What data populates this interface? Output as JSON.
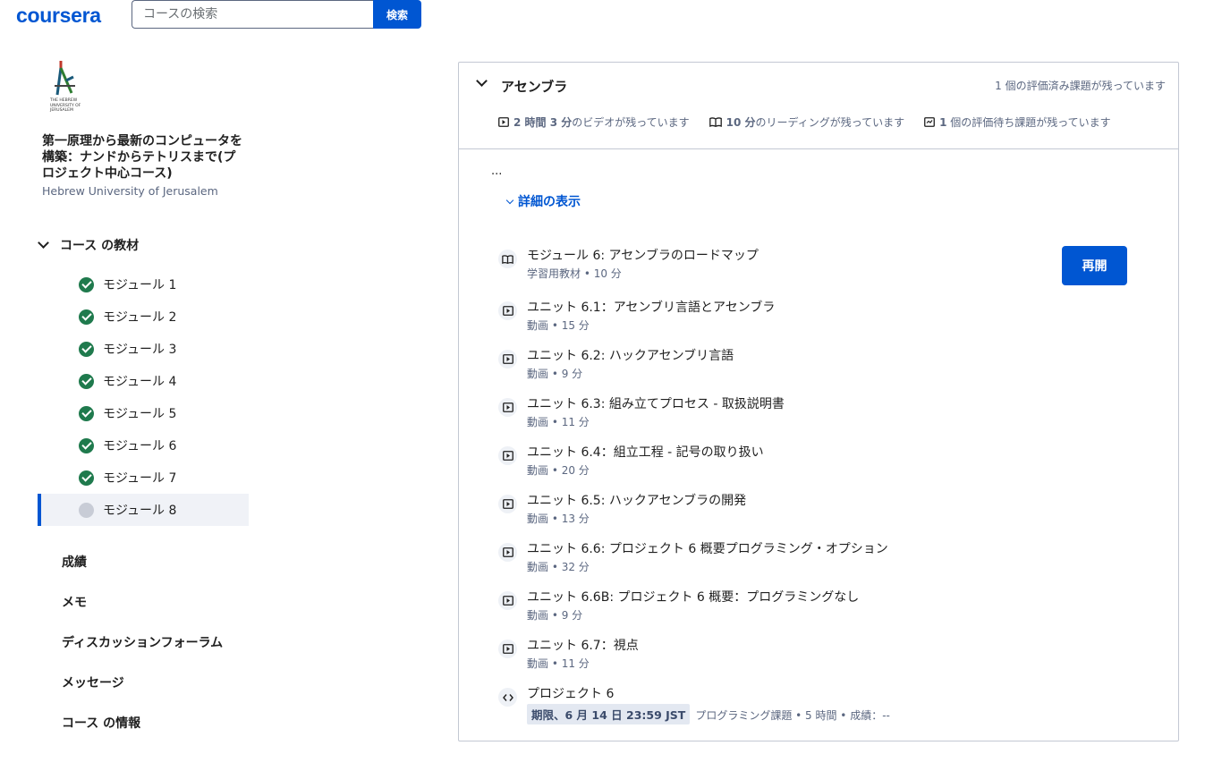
{
  "header": {
    "logo": "coursera",
    "search_placeholder": "コースの検索",
    "search_button": "検索"
  },
  "sidebar": {
    "university_logo_text": "THE HEBREW UNIVERSITY OF JERUSALEM",
    "course_title": "第一原理から最新のコンピュータを構築：ナンドからテトリスまで(プロジェクト中心コース)",
    "university": "Hebrew University of Jerusalem",
    "materials_label": "コース の教材",
    "modules": [
      {
        "label": "モジュール 1",
        "status": "completed"
      },
      {
        "label": "モジュール 2",
        "status": "completed"
      },
      {
        "label": "モジュール 3",
        "status": "completed"
      },
      {
        "label": "モジュール 4",
        "status": "completed"
      },
      {
        "label": "モジュール 5",
        "status": "completed"
      },
      {
        "label": "モジュール 6",
        "status": "completed"
      },
      {
        "label": "モジュール 7",
        "status": "completed"
      },
      {
        "label": "モジュール 8",
        "status": "in-progress"
      }
    ],
    "nav": [
      "成績",
      "メモ",
      "ディスカッションフォーラム",
      "メッセージ",
      "コース の情報"
    ]
  },
  "section": {
    "title": "アセンブラ",
    "graded_remaining": "1 個の評価済み課題が残っています",
    "stats": {
      "video_bold": "2 時間 3 分",
      "video_rest": "のビデオが残っています",
      "reading_bold": "10 分",
      "reading_rest": "のリーディングが残っています",
      "pending_bold": "1",
      "pending_rest": "個の評価待ち課題が残っています"
    },
    "ellipsis": "...",
    "show_more": "詳細の表示",
    "resume_button": "再開",
    "items": [
      {
        "type": "reading",
        "title": "モジュール 6: アセンブラのロードマップ",
        "meta": "学習用教材 • 10 分"
      },
      {
        "type": "video",
        "title": "ユニット 6.1：アセンブリ言語とアセンブラ",
        "meta": "動画 • 15 分"
      },
      {
        "type": "video",
        "title": "ユニット 6.2: ハックアセンブリ言語",
        "meta": "動画 • 9 分"
      },
      {
        "type": "video",
        "title": "ユニット 6.3: 組み立てプロセス - 取扱説明書",
        "meta": "動画 • 11 分"
      },
      {
        "type": "video",
        "title": "ユニット 6.4：組立工程 - 記号の取り扱い",
        "meta": "動画 • 20 分"
      },
      {
        "type": "video",
        "title": "ユニット 6.5: ハックアセンブラの開発",
        "meta": "動画 • 13 分"
      },
      {
        "type": "video",
        "title": "ユニット 6.6: プロジェクト 6 概要プログラミング・オプション",
        "meta": "動画 • 32 分"
      },
      {
        "type": "video",
        "title": "ユニット 6.6B: プロジェクト 6 概要：プログラミングなし",
        "meta": "動画 • 9 分"
      },
      {
        "type": "video",
        "title": "ユニット 6.7：視点",
        "meta": "動画 • 11 分"
      },
      {
        "type": "code",
        "title": "プロジェクト 6",
        "deadline": "期限、6 月 14 日 23:59 JST",
        "meta": "プログラミング課題 • 5 時間 • 成績：--"
      }
    ]
  }
}
